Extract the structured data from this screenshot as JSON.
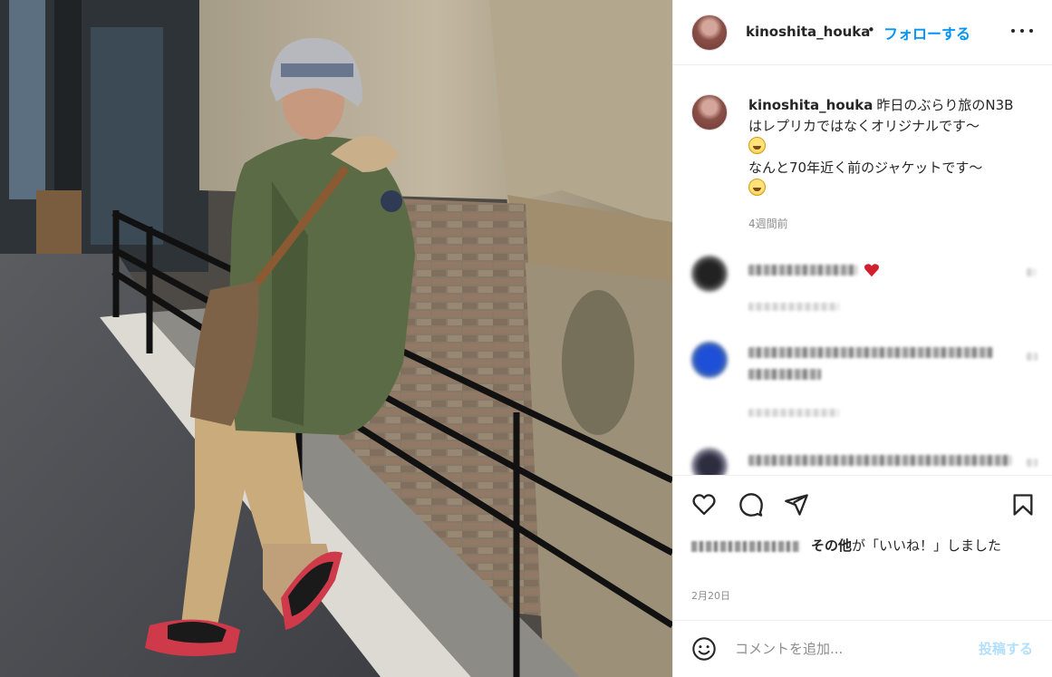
{
  "post": {
    "username": "kinoshita_houka",
    "dot": "•",
    "follow_label": "フォローする",
    "more_icon": "more-horizontal-icon"
  },
  "caption": {
    "username": "kinoshita_houka",
    "line1": "昨日のぶらり旅のN3B",
    "line2": "はレプリカではなくオリジナルです～",
    "line3": "なんと70年近く前のジャケットです～",
    "time": "4週間前"
  },
  "actions": {
    "like_icon": "heart-icon",
    "comment_icon": "comment-icon",
    "share_icon": "paper-plane-icon",
    "save_icon": "bookmark-icon"
  },
  "likes": {
    "others_label": "その他",
    "suffix": "が「いいね！」しました"
  },
  "date": "2月20日",
  "comment_box": {
    "placeholder": "コメントを追加...",
    "post_label": "投稿する",
    "post_color": "#b2dffc"
  },
  "colors": {
    "accent": "#0095f6",
    "text": "#262626",
    "muted": "#8e8e8e",
    "border": "#efefef"
  }
}
